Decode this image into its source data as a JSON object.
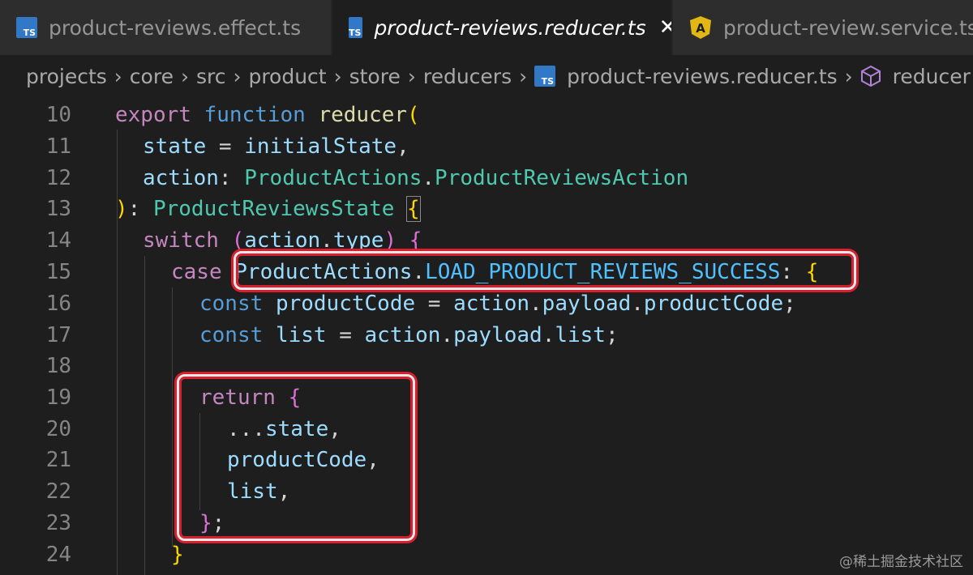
{
  "tabs": [
    {
      "label": "product-reviews.effect.ts",
      "icon": "typescript-file-icon",
      "icon_text": "TS",
      "active": false
    },
    {
      "label": "product-reviews.reducer.ts",
      "icon": "typescript-file-icon",
      "icon_text": "TS",
      "active": true,
      "close": "✕"
    },
    {
      "label": "product-review.service.ts",
      "icon": "angular-file-icon",
      "icon_text": "A",
      "active": false
    }
  ],
  "breadcrumb": {
    "items": [
      "projects",
      "core",
      "src",
      "product",
      "store",
      "reducers"
    ],
    "file": "product-reviews.reducer.ts",
    "file_icon_text": "TS",
    "symbol": "reducer",
    "separator": "›"
  },
  "code": {
    "lines": [
      {
        "n": "10"
      },
      {
        "n": "11"
      },
      {
        "n": "12"
      },
      {
        "n": "13"
      },
      {
        "n": "14"
      },
      {
        "n": "15"
      },
      {
        "n": "16"
      },
      {
        "n": "17"
      },
      {
        "n": "18"
      },
      {
        "n": "19"
      },
      {
        "n": "20"
      },
      {
        "n": "21"
      },
      {
        "n": "22"
      },
      {
        "n": "23"
      },
      {
        "n": "24"
      }
    ],
    "tokens": {
      "l10": [
        "export",
        " ",
        "function",
        " ",
        "reducer",
        "("
      ],
      "l11": [
        "state",
        " = ",
        "initialState",
        ","
      ],
      "l12": [
        "action",
        ": ",
        "ProductActions",
        ".",
        "ProductReviewsAction"
      ],
      "l13": [
        ")",
        ": ",
        "ProductReviewsState",
        " ",
        "{"
      ],
      "l14": [
        "switch",
        " ",
        "(",
        "action",
        ".",
        "type",
        ")",
        " ",
        "{"
      ],
      "l15": [
        "case",
        " ",
        "ProductActions",
        ".",
        "LOAD_PRODUCT_REVIEWS_SUCCESS",
        ":",
        " ",
        "{"
      ],
      "l16": [
        "const",
        " ",
        "productCode",
        " = ",
        "action",
        ".",
        "payload",
        ".",
        "productCode",
        ";"
      ],
      "l17": [
        "const",
        " ",
        "list",
        " = ",
        "action",
        ".",
        "payload",
        ".",
        "list",
        ";"
      ],
      "l19": [
        "return",
        " ",
        "{"
      ],
      "l20": [
        "...",
        "state",
        ","
      ],
      "l21": [
        "productCode",
        ","
      ],
      "l22": [
        "list",
        ","
      ],
      "l23": [
        "}",
        ";"
      ],
      "l24": [
        "}"
      ]
    }
  },
  "watermark": "@稀土掘金技术社区",
  "colors": {
    "highlight_border": "#d91e2e",
    "editor_bg": "#1e1e1e",
    "tab_bg": "#2d2d2d"
  }
}
